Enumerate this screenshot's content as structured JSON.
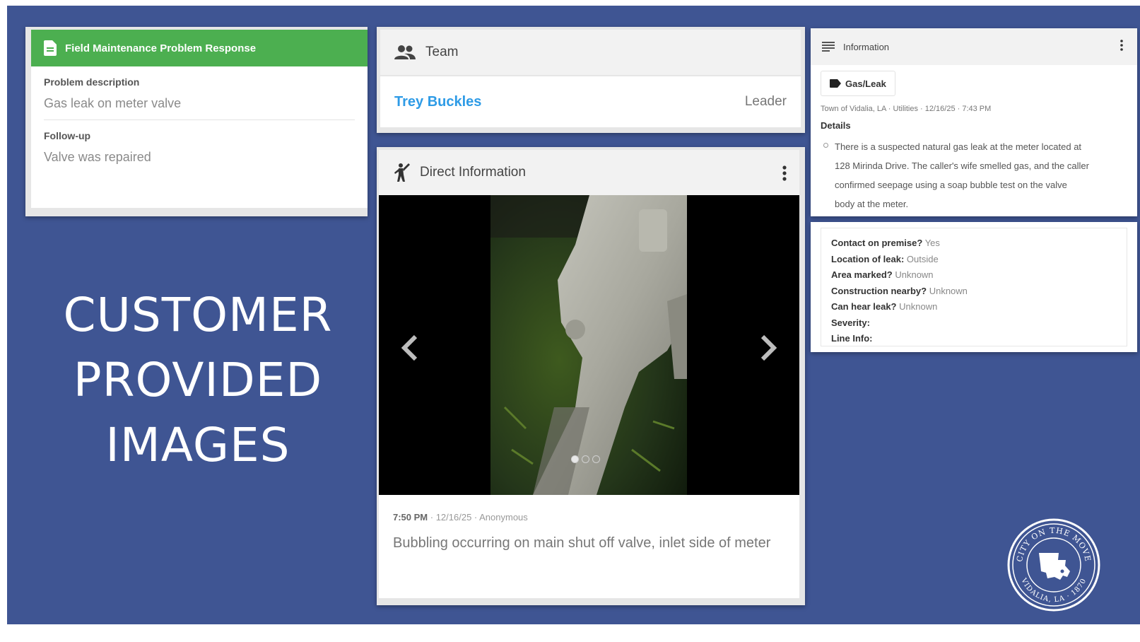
{
  "field_maintenance": {
    "title": "Field Maintenance Problem Response",
    "problem_label": "Problem description",
    "problem_value": "Gas leak on meter valve",
    "followup_label": "Follow-up",
    "followup_value": "Valve was repaired"
  },
  "slide_title": {
    "line1": "CUSTOMER",
    "line2": "PROVIDED",
    "line3": "IMAGES"
  },
  "team": {
    "header": "Team",
    "member_name": "Trey Buckles",
    "member_role": "Leader"
  },
  "direct_info": {
    "header": "Direct Information",
    "carousel_slide_count": 3,
    "carousel_active_index": 0,
    "time": "7:50 PM",
    "meta_rest": " · 12/16/25 · Anonymous",
    "description": "Bubbling occurring on main shut off valve, inlet side of meter"
  },
  "information": {
    "header": "Information",
    "tag": "Gas/Leak",
    "source": "Town of Vidalia, LA · Utilities · 12/16/25 · 7:43 PM",
    "details_label": "Details",
    "details_text": "There is a suspected natural gas leak at the meter located at 128 Mirinda Drive. The caller's wife smelled gas, and the caller confirmed seepage using a soap bubble test on the valve body at the meter."
  },
  "answers": [
    {
      "q": "Contact on premise?",
      "a": "Yes"
    },
    {
      "q": "Location of leak:",
      "a": "Outside"
    },
    {
      "q": "Area marked?",
      "a": "Unknown"
    },
    {
      "q": "Construction nearby?",
      "a": "Unknown"
    },
    {
      "q": "Can hear leak?",
      "a": "Unknown"
    },
    {
      "q": "Severity:",
      "a": ""
    },
    {
      "q": "Line Info:",
      "a": ""
    }
  ],
  "seal": {
    "top_text": "CITY ON THE MOVE",
    "bottom_text": "VIDALIA, LA · 1870"
  },
  "colors": {
    "slide_background": "#3f5593",
    "header_green": "#4caf50",
    "link_blue": "#2e9be6"
  }
}
